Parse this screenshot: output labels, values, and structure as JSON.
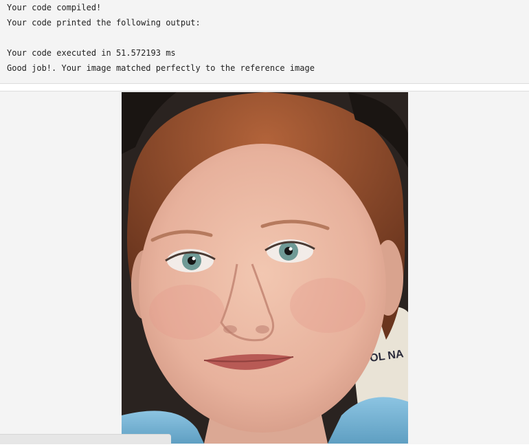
{
  "console": {
    "lines": [
      "Your code compiled!",
      "Your code printed the following output:",
      "",
      "Your code executed in 51.572193 ms",
      "Good job!. Your image matched perfectly to the reference image"
    ]
  },
  "result_image": {
    "description_alt": "Output image",
    "shirt_text": "OL NA",
    "colors": {
      "background": "#2b2522",
      "hair": "#9a4f2a",
      "skin": "#e9b8a2",
      "lips": "#b85a55",
      "eyes": "#6f9a96",
      "shirt": "#7fb7d6"
    }
  }
}
